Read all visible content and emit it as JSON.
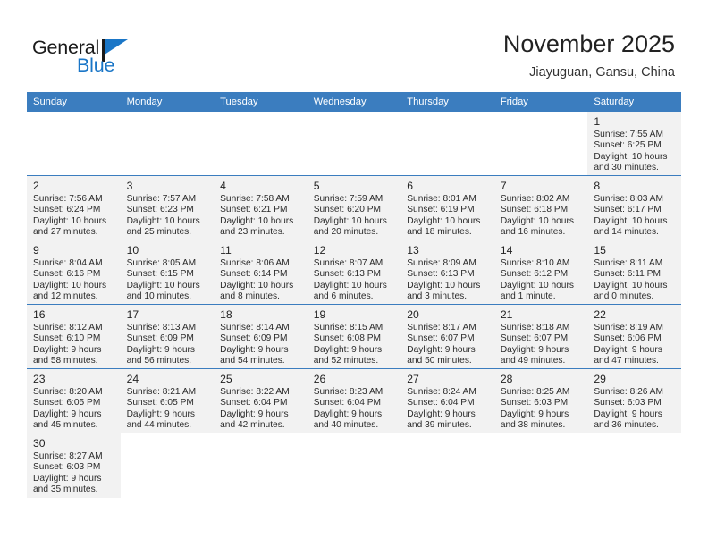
{
  "brand": {
    "name_top": "General",
    "name_bottom": "Blue",
    "color_black": "#1a1a1a",
    "color_blue": "#1a76c7"
  },
  "header": {
    "title": "November 2025",
    "subtitle": "Jiayuguan, Gansu, China"
  },
  "theme": {
    "header_bg": "#3b7dbf",
    "header_text": "#ffffff",
    "cell_shade": "#f2f2f2",
    "grid_line": "#3b7dbf"
  },
  "weekdays": [
    "Sunday",
    "Monday",
    "Tuesday",
    "Wednesday",
    "Thursday",
    "Friday",
    "Saturday"
  ],
  "labels": {
    "sunrise": "Sunrise:",
    "sunset": "Sunset:",
    "daylight": "Daylight:"
  },
  "weeks": [
    [
      {
        "day": ""
      },
      {
        "day": ""
      },
      {
        "day": ""
      },
      {
        "day": ""
      },
      {
        "day": ""
      },
      {
        "day": ""
      },
      {
        "day": "1",
        "sunrise": "Sunrise: 7:55 AM",
        "sunset": "Sunset: 6:25 PM",
        "daylight_1": "Daylight: 10 hours",
        "daylight_2": "and 30 minutes."
      }
    ],
    [
      {
        "day": "2",
        "sunrise": "Sunrise: 7:56 AM",
        "sunset": "Sunset: 6:24 PM",
        "daylight_1": "Daylight: 10 hours",
        "daylight_2": "and 27 minutes."
      },
      {
        "day": "3",
        "sunrise": "Sunrise: 7:57 AM",
        "sunset": "Sunset: 6:23 PM",
        "daylight_1": "Daylight: 10 hours",
        "daylight_2": "and 25 minutes."
      },
      {
        "day": "4",
        "sunrise": "Sunrise: 7:58 AM",
        "sunset": "Sunset: 6:21 PM",
        "daylight_1": "Daylight: 10 hours",
        "daylight_2": "and 23 minutes."
      },
      {
        "day": "5",
        "sunrise": "Sunrise: 7:59 AM",
        "sunset": "Sunset: 6:20 PM",
        "daylight_1": "Daylight: 10 hours",
        "daylight_2": "and 20 minutes."
      },
      {
        "day": "6",
        "sunrise": "Sunrise: 8:01 AM",
        "sunset": "Sunset: 6:19 PM",
        "daylight_1": "Daylight: 10 hours",
        "daylight_2": "and 18 minutes."
      },
      {
        "day": "7",
        "sunrise": "Sunrise: 8:02 AM",
        "sunset": "Sunset: 6:18 PM",
        "daylight_1": "Daylight: 10 hours",
        "daylight_2": "and 16 minutes."
      },
      {
        "day": "8",
        "sunrise": "Sunrise: 8:03 AM",
        "sunset": "Sunset: 6:17 PM",
        "daylight_1": "Daylight: 10 hours",
        "daylight_2": "and 14 minutes."
      }
    ],
    [
      {
        "day": "9",
        "sunrise": "Sunrise: 8:04 AM",
        "sunset": "Sunset: 6:16 PM",
        "daylight_1": "Daylight: 10 hours",
        "daylight_2": "and 12 minutes."
      },
      {
        "day": "10",
        "sunrise": "Sunrise: 8:05 AM",
        "sunset": "Sunset: 6:15 PM",
        "daylight_1": "Daylight: 10 hours",
        "daylight_2": "and 10 minutes."
      },
      {
        "day": "11",
        "sunrise": "Sunrise: 8:06 AM",
        "sunset": "Sunset: 6:14 PM",
        "daylight_1": "Daylight: 10 hours",
        "daylight_2": "and 8 minutes."
      },
      {
        "day": "12",
        "sunrise": "Sunrise: 8:07 AM",
        "sunset": "Sunset: 6:13 PM",
        "daylight_1": "Daylight: 10 hours",
        "daylight_2": "and 6 minutes."
      },
      {
        "day": "13",
        "sunrise": "Sunrise: 8:09 AM",
        "sunset": "Sunset: 6:13 PM",
        "daylight_1": "Daylight: 10 hours",
        "daylight_2": "and 3 minutes."
      },
      {
        "day": "14",
        "sunrise": "Sunrise: 8:10 AM",
        "sunset": "Sunset: 6:12 PM",
        "daylight_1": "Daylight: 10 hours",
        "daylight_2": "and 1 minute."
      },
      {
        "day": "15",
        "sunrise": "Sunrise: 8:11 AM",
        "sunset": "Sunset: 6:11 PM",
        "daylight_1": "Daylight: 10 hours",
        "daylight_2": "and 0 minutes."
      }
    ],
    [
      {
        "day": "16",
        "sunrise": "Sunrise: 8:12 AM",
        "sunset": "Sunset: 6:10 PM",
        "daylight_1": "Daylight: 9 hours",
        "daylight_2": "and 58 minutes."
      },
      {
        "day": "17",
        "sunrise": "Sunrise: 8:13 AM",
        "sunset": "Sunset: 6:09 PM",
        "daylight_1": "Daylight: 9 hours",
        "daylight_2": "and 56 minutes."
      },
      {
        "day": "18",
        "sunrise": "Sunrise: 8:14 AM",
        "sunset": "Sunset: 6:09 PM",
        "daylight_1": "Daylight: 9 hours",
        "daylight_2": "and 54 minutes."
      },
      {
        "day": "19",
        "sunrise": "Sunrise: 8:15 AM",
        "sunset": "Sunset: 6:08 PM",
        "daylight_1": "Daylight: 9 hours",
        "daylight_2": "and 52 minutes."
      },
      {
        "day": "20",
        "sunrise": "Sunrise: 8:17 AM",
        "sunset": "Sunset: 6:07 PM",
        "daylight_1": "Daylight: 9 hours",
        "daylight_2": "and 50 minutes."
      },
      {
        "day": "21",
        "sunrise": "Sunrise: 8:18 AM",
        "sunset": "Sunset: 6:07 PM",
        "daylight_1": "Daylight: 9 hours",
        "daylight_2": "and 49 minutes."
      },
      {
        "day": "22",
        "sunrise": "Sunrise: 8:19 AM",
        "sunset": "Sunset: 6:06 PM",
        "daylight_1": "Daylight: 9 hours",
        "daylight_2": "and 47 minutes."
      }
    ],
    [
      {
        "day": "23",
        "sunrise": "Sunrise: 8:20 AM",
        "sunset": "Sunset: 6:05 PM",
        "daylight_1": "Daylight: 9 hours",
        "daylight_2": "and 45 minutes."
      },
      {
        "day": "24",
        "sunrise": "Sunrise: 8:21 AM",
        "sunset": "Sunset: 6:05 PM",
        "daylight_1": "Daylight: 9 hours",
        "daylight_2": "and 44 minutes."
      },
      {
        "day": "25",
        "sunrise": "Sunrise: 8:22 AM",
        "sunset": "Sunset: 6:04 PM",
        "daylight_1": "Daylight: 9 hours",
        "daylight_2": "and 42 minutes."
      },
      {
        "day": "26",
        "sunrise": "Sunrise: 8:23 AM",
        "sunset": "Sunset: 6:04 PM",
        "daylight_1": "Daylight: 9 hours",
        "daylight_2": "and 40 minutes."
      },
      {
        "day": "27",
        "sunrise": "Sunrise: 8:24 AM",
        "sunset": "Sunset: 6:04 PM",
        "daylight_1": "Daylight: 9 hours",
        "daylight_2": "and 39 minutes."
      },
      {
        "day": "28",
        "sunrise": "Sunrise: 8:25 AM",
        "sunset": "Sunset: 6:03 PM",
        "daylight_1": "Daylight: 9 hours",
        "daylight_2": "and 38 minutes."
      },
      {
        "day": "29",
        "sunrise": "Sunrise: 8:26 AM",
        "sunset": "Sunset: 6:03 PM",
        "daylight_1": "Daylight: 9 hours",
        "daylight_2": "and 36 minutes."
      }
    ],
    [
      {
        "day": "30",
        "sunrise": "Sunrise: 8:27 AM",
        "sunset": "Sunset: 6:03 PM",
        "daylight_1": "Daylight: 9 hours",
        "daylight_2": "and 35 minutes."
      },
      {
        "day": ""
      },
      {
        "day": ""
      },
      {
        "day": ""
      },
      {
        "day": ""
      },
      {
        "day": ""
      },
      {
        "day": ""
      }
    ]
  ]
}
